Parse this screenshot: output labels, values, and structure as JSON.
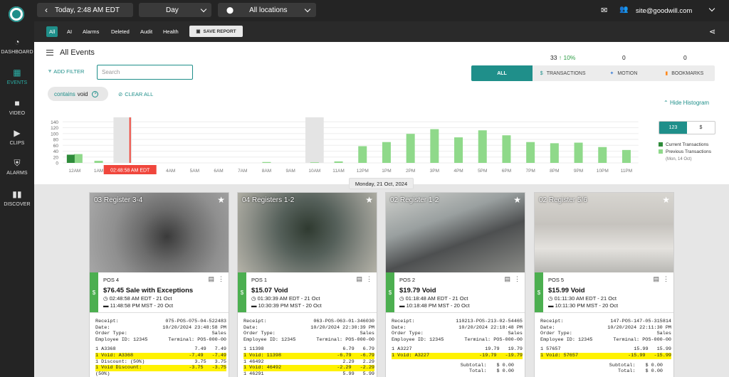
{
  "sidebar": {
    "items": [
      {
        "label": "DASHBOARD",
        "icon": "gauge-icon"
      },
      {
        "label": "EVENTS",
        "icon": "grid-icon"
      },
      {
        "label": "VIDEO",
        "icon": "camera-icon"
      },
      {
        "label": "CLIPS",
        "icon": "clip-icon"
      },
      {
        "label": "ALARMS",
        "icon": "shield-icon"
      },
      {
        "label": "DISCOVER",
        "icon": "bar-chart-icon"
      }
    ],
    "active": "EVENTS"
  },
  "topbar": {
    "date": "Today, 2:48 AM EDT",
    "range": "Day",
    "locations": "All locations",
    "user": "site@goodwill.com"
  },
  "subbar": {
    "tabs": [
      "All",
      "AI",
      "Alarms",
      "Deleted",
      "Audit",
      "Health"
    ],
    "active_tab": "All",
    "save_label": "SAVE REPORT"
  },
  "events": {
    "title": "All Events",
    "add_filter": "ADD FILTER",
    "search_placeholder": "Search",
    "filter_chip": {
      "prefix": "contains",
      "value": "void"
    },
    "clear_all": "CLEAR ALL",
    "counts": {
      "transactions": "33",
      "transactions_change": "10%",
      "motion": "0",
      "bookmarks": "0"
    },
    "segments": [
      "ALL",
      "TRANSACTIONS",
      "MOTION",
      "BOOKMARKS"
    ],
    "hide_histogram": "Hide Histogram",
    "toggle": [
      "123",
      "$"
    ],
    "legend": {
      "current": "Current Transactions",
      "previous": "Previous Transactions",
      "previous_date": "(Mon, 14 Oct)"
    },
    "date_label": "Monday, 21 Oct, 2024"
  },
  "chart_data": {
    "type": "bar",
    "categories": [
      "12AM",
      "1AM",
      "2AM",
      "3AM",
      "4AM",
      "5AM",
      "6AM",
      "7AM",
      "8AM",
      "9AM",
      "10AM",
      "11AM",
      "12PM",
      "1PM",
      "2PM",
      "3PM",
      "4PM",
      "5PM",
      "6PM",
      "7PM",
      "8PM",
      "9PM",
      "10PM",
      "11PM"
    ],
    "series": [
      {
        "name": "Current Transactions",
        "color": "#2e8b3a",
        "values": [
          28,
          0,
          0,
          0,
          0,
          0,
          0,
          0,
          0,
          0,
          0,
          0,
          0,
          0,
          0,
          0,
          0,
          0,
          0,
          0,
          0,
          0,
          0,
          0
        ]
      },
      {
        "name": "Previous Transactions",
        "color": "#8fd98a",
        "values": [
          30,
          7,
          0,
          0,
          0,
          0,
          0,
          0,
          3,
          0,
          2,
          5,
          57,
          71,
          99,
          115,
          87,
          111,
          94,
          71,
          67,
          69,
          54,
          44
        ]
      }
    ],
    "ylim": [
      0,
      160
    ],
    "yticks": [
      0,
      20,
      40,
      60,
      80,
      100,
      120,
      140
    ],
    "gridlines": true,
    "highlighted_hours": [
      "2AM",
      "10AM"
    ],
    "cursor_label": "02:48:58 AM EDT",
    "cursor_hour": 2.81
  },
  "cards": [
    {
      "camera": "03 Register 3-4",
      "pos": "POS 4",
      "title": "$76.45 Sale with Exceptions",
      "time1": "02:48:58 AM EDT - 21 Oct",
      "time2": "11:48:58 PM MST - 20 Oct",
      "receipt_header": [
        [
          "Receipt:",
          "075-POS-075-04-522483"
        ],
        [
          "Date:",
          "10/20/2024 23:48:58 PM"
        ],
        [
          "Order Type:",
          "Sales"
        ],
        [
          "Employee ID: 12345",
          "Terminal: POS-000-00"
        ]
      ],
      "lines": [
        [
          "1 A3368",
          "7.49",
          "7.49",
          false
        ],
        [
          "1 Void: A3368",
          "-7.49",
          "-7.49",
          true
        ],
        [
          "1 Discount: (50%)",
          "3.75",
          "3.75",
          false
        ],
        [
          "1 Void Discount:",
          "-3.75",
          "-3.75",
          true
        ],
        [
          "(50%)",
          "",
          "",
          false
        ]
      ]
    },
    {
      "camera": "04 Registers 1-2",
      "pos": "POS 1",
      "title": "$15.07 Void",
      "time1": "01:30:39 AM EDT - 21 Oct",
      "time2": "10:30:39 PM MST - 20 Oct",
      "receipt_header": [
        [
          "Receipt:",
          "063-POS-063-01-346030"
        ],
        [
          "Date:",
          "10/20/2024 22:30:39 PM"
        ],
        [
          "Order Type:",
          "Sales"
        ],
        [
          "Employee ID: 12345",
          "Terminal: POS-000-00"
        ]
      ],
      "lines": [
        [
          "1 11398",
          "6.79",
          "6.79",
          false
        ],
        [
          "1 Void: 11398",
          "-6.79",
          "-6.79",
          true
        ],
        [
          "1 46492",
          "2.29",
          "2.29",
          false
        ],
        [
          "1 Void: 46492",
          "-2.29",
          "-2.29",
          true
        ],
        [
          "1 46291",
          "5.99",
          "5.99",
          false
        ]
      ]
    },
    {
      "camera": "02 Register 1-2",
      "pos": "POS 2",
      "title": "$19.79 Void",
      "time1": "01:18:48 AM EDT - 21 Oct",
      "time2": "10:18:48 PM MST - 20 Oct",
      "receipt_header": [
        [
          "Receipt:",
          "110213-POS-213-02-54465"
        ],
        [
          "Date:",
          "10/20/2024 22:18:48 PM"
        ],
        [
          "Order Type:",
          "Sales"
        ],
        [
          "Employee ID: 12345",
          "Terminal: POS-000-00"
        ]
      ],
      "lines": [
        [
          "1 A3227",
          "19.79",
          "19.79",
          false
        ],
        [
          "1 Void: A3227",
          "-19.79",
          "-19.79",
          true
        ]
      ],
      "totals": [
        [
          "Subtotal:",
          "$ 0.00"
        ],
        [
          "Total:",
          "$ 0.00"
        ]
      ]
    },
    {
      "camera": "02 Register 5/6",
      "pos": "POS 5",
      "title": "$15.99 Void",
      "time1": "01:11:30 AM EDT - 21 Oct",
      "time2": "10:11:30 PM MST - 20 Oct",
      "receipt_header": [
        [
          "Receipt:",
          "147-POS-147-05-315814"
        ],
        [
          "Date:",
          "10/20/2024 22:11:30 PM"
        ],
        [
          "Order Type:",
          "Sales"
        ],
        [
          "Employee ID: 12345",
          "Terminal: POS-000-00"
        ]
      ],
      "lines": [
        [
          "1 57657",
          "15.99",
          "15.99",
          false
        ],
        [
          "1 Void: 57657",
          "-15.99",
          "-15.99",
          true
        ]
      ],
      "totals": [
        [
          "Subtotal:",
          "$ 0.00"
        ],
        [
          "Total:",
          "$ 0.00"
        ]
      ]
    }
  ]
}
